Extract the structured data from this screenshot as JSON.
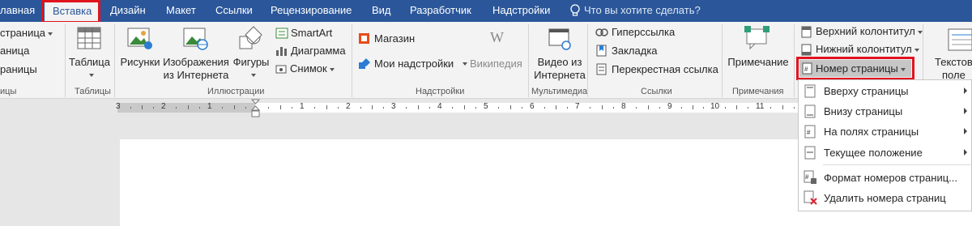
{
  "tabs": {
    "home": "лавная",
    "insert": "Вставка",
    "design": "Дизайн",
    "layout": "Макет",
    "references": "Ссылки",
    "review": "Рецензирование",
    "view": "Вид",
    "developer": "Разработчик",
    "addins": "Надстройки",
    "tellme": "Что вы хотите сделать?"
  },
  "ribbon": {
    "pages": {
      "cover_page": "страница",
      "blank_page": "аница",
      "page_break": "раницы",
      "group": "ицы"
    },
    "tables": {
      "table": "Таблица",
      "group": "Таблицы"
    },
    "illustrations": {
      "pictures": "Рисунки",
      "online_pictures_1": "Изображения",
      "online_pictures_2": "из Интернета",
      "shapes": "Фигуры",
      "smartart": "SmartArt",
      "chart": "Диаграмма",
      "screenshot": "Снимок",
      "group": "Иллюстрации"
    },
    "addins": {
      "store": "Магазин",
      "my_addins": "Мои надстройки",
      "wikipedia": "Википедия",
      "group": "Надстройки"
    },
    "media": {
      "video_1": "Видео из",
      "video_2": "Интернета",
      "group": "Мультимедиа"
    },
    "links": {
      "hyperlink": "Гиперссылка",
      "bookmark": "Закладка",
      "cross_reference": "Перекрестная ссылка",
      "group": "Ссылки"
    },
    "comments": {
      "comment": "Примечание",
      "group": "Примечания"
    },
    "header_footer": {
      "header": "Верхний колонтитул",
      "footer": "Нижний колонтитул",
      "page_number": "Номер страницы"
    },
    "text": {
      "textbox_1": "Текстов",
      "textbox_2": "поле"
    }
  },
  "ruler": {
    "numbers_left": [
      "3",
      "2",
      "1"
    ],
    "numbers_right": [
      "1",
      "2",
      "3",
      "4",
      "5",
      "6",
      "7",
      "8",
      "9",
      "10",
      "11",
      "12",
      "13"
    ]
  },
  "page_number_menu": {
    "top_of_page": "Вверху страницы",
    "bottom_of_page": "Внизу страницы",
    "page_margins": "На полях страницы",
    "current_position": "Текущее положение",
    "format": "Формат номеров страниц...",
    "remove": "Удалить номера страниц"
  },
  "colors": {
    "ribbon_tab_bar": "#2b579a",
    "highlight": "#e1141e"
  }
}
